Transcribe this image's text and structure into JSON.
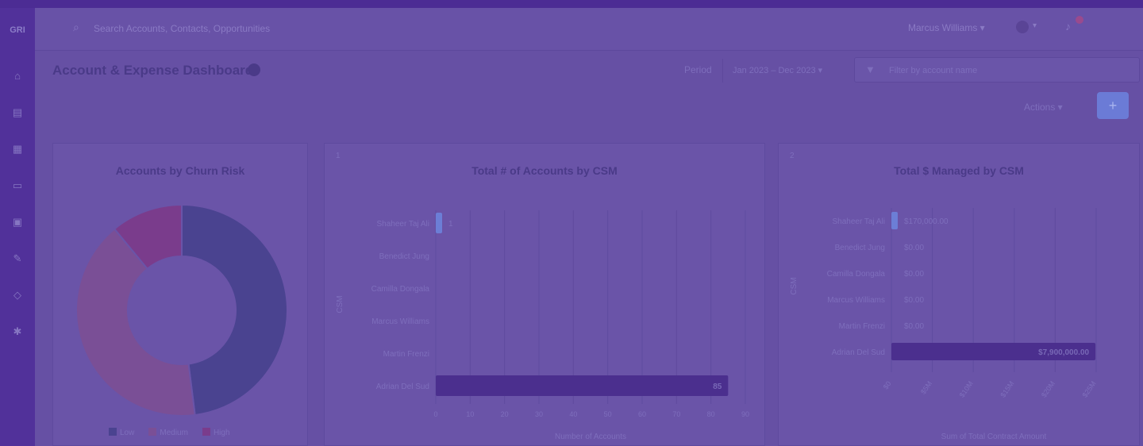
{
  "app": {
    "logo": "GRI"
  },
  "topbar": {
    "search_placeholder": "Search Accounts, Contacts, Opportunities",
    "user_menu": "Marcus Williams ▾"
  },
  "header": {
    "title": "Account & Expense Dashboard",
    "period_label": "Period",
    "date_range": "Jan 2023 – Dec 2023 ▾",
    "filter_placeholder": "Filter by account name"
  },
  "toolbar": {
    "actions_label": "Actions ▾",
    "add_label": "+"
  },
  "panels": {
    "risk": {
      "title": "Accounts by Churn Risk",
      "legend": [
        {
          "label": "Low",
          "color": "#4a4390"
        },
        {
          "label": "Medium",
          "color": "#7a4f96"
        },
        {
          "label": "High",
          "color": "#7a3c8c"
        }
      ]
    },
    "count": {
      "number": "1",
      "title": "Total # of Accounts by CSM",
      "ylabel": "CSM",
      "xlabel": "Number of Accounts"
    },
    "managed": {
      "number": "2",
      "title": "Total $ Managed by CSM",
      "ylabel": "CSM",
      "xlabel": "Sum of Total Contract Amount"
    }
  },
  "chart_data": [
    {
      "type": "pie",
      "title": "Accounts by Churn Risk",
      "categories": [
        "Low",
        "Medium",
        "High"
      ],
      "values": [
        48,
        41,
        11
      ],
      "colors": [
        "#4a4390",
        "#7a4f96",
        "#7a3c8c"
      ]
    },
    {
      "type": "bar",
      "title": "Total # of Accounts by CSM",
      "orientation": "horizontal",
      "categories": [
        "Shaheer Taj Ali",
        "Benedict Jung",
        "Camilla Dongala",
        "Marcus Williams",
        "Martin Frenzi",
        "Adrian Del Sud"
      ],
      "values": [
        1,
        0,
        0,
        0,
        0,
        85
      ],
      "value_labels": [
        "1",
        "",
        "",
        "",
        "",
        "85"
      ],
      "xlim": [
        0,
        90
      ],
      "xticks": [
        0,
        10,
        20,
        30,
        40,
        50,
        60,
        70,
        80,
        90
      ],
      "xlabel": "Number of Accounts",
      "ylabel": "CSM"
    },
    {
      "type": "bar",
      "title": "Total $ Managed by CSM",
      "orientation": "horizontal",
      "categories": [
        "Shaheer Taj Ali",
        "Benedict Jung",
        "Camilla Dongala",
        "Marcus Williams",
        "Martin Frenzi",
        "Adrian Del Sud"
      ],
      "values": [
        170000,
        0,
        0,
        0,
        0,
        27900000
      ],
      "value_labels": [
        "$170,000.00",
        "$0.00",
        "$0.00",
        "$0.00",
        "$0.00",
        "$7,900,000.00"
      ],
      "xlim": [
        0,
        28000000
      ],
      "xticks": [
        "$0",
        "$5M",
        "$10M",
        "$15M",
        "$20M",
        "$25M"
      ],
      "xlabel": "Sum of Total Contract Amount",
      "ylabel": "CSM"
    }
  ]
}
